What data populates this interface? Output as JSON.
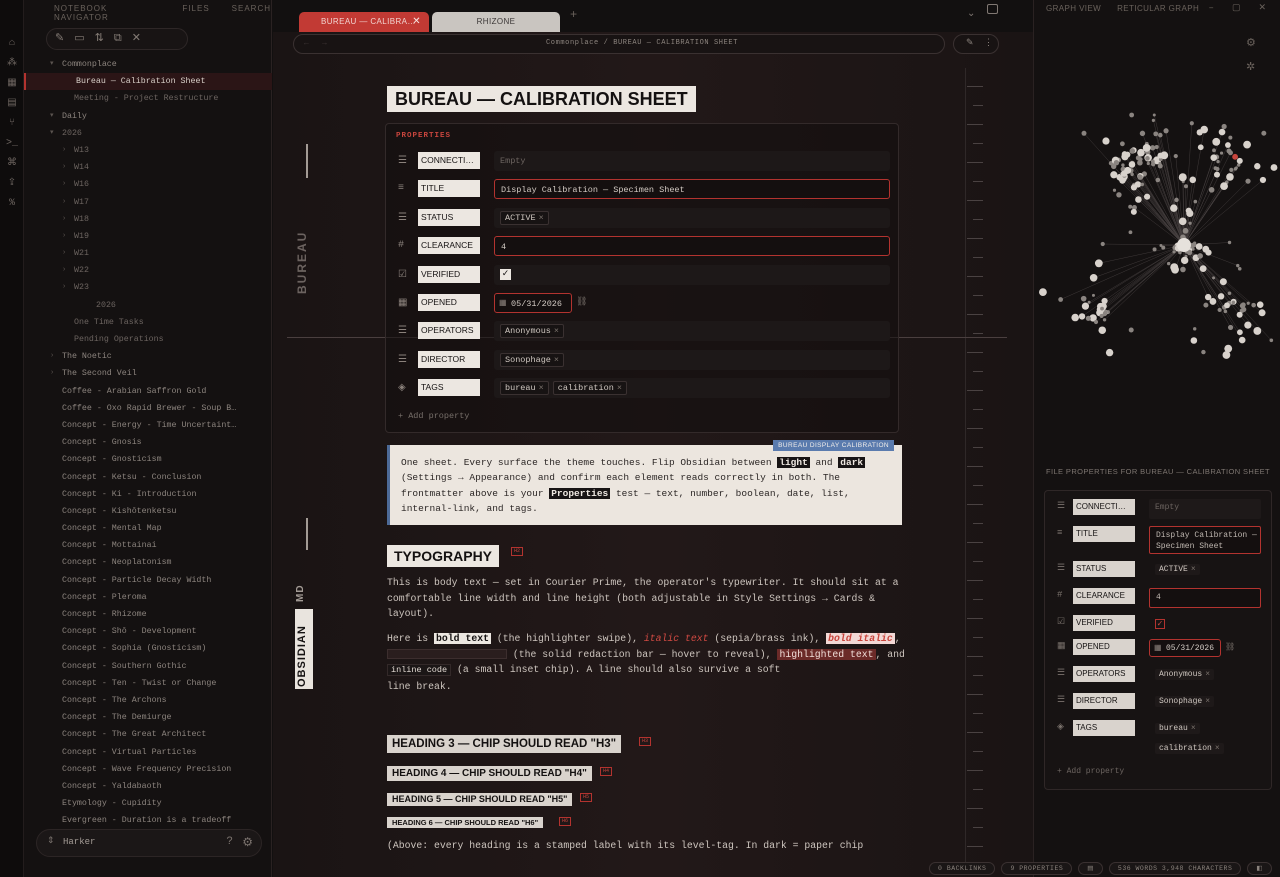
{
  "left_tabs": [
    "NOTEBOOK NAVIGATOR",
    "FILES",
    "SEARCH"
  ],
  "ribbon_icons": [
    "files-icon",
    "graph-icon",
    "calendar-icon",
    "template-icon",
    "branch-icon",
    "terminal-icon",
    "command-icon",
    "publish-icon",
    "tag-icon"
  ],
  "tree": [
    {
      "label": "Commonplace",
      "indent": 1,
      "caret": "▾"
    },
    {
      "label": "Bureau — Calibration Sheet",
      "indent": 3,
      "active": true
    },
    {
      "label": "Meeting - Project Restructure",
      "indent": 3
    },
    {
      "label": "Daily",
      "indent": 1,
      "caret": "▾"
    },
    {
      "label": "2026",
      "indent": 2,
      "caret": "▾"
    },
    {
      "label": "W13",
      "indent": 3,
      "caret": "›"
    },
    {
      "label": "W14",
      "indent": 3,
      "caret": "›"
    },
    {
      "label": "W16",
      "indent": 3,
      "caret": "›"
    },
    {
      "label": "W17",
      "indent": 3,
      "caret": "›"
    },
    {
      "label": "W18",
      "indent": 3,
      "caret": "›"
    },
    {
      "label": "W19",
      "indent": 3,
      "caret": "›"
    },
    {
      "label": "W21",
      "indent": 3,
      "caret": "›"
    },
    {
      "label": "W22",
      "indent": 3,
      "caret": "›"
    },
    {
      "label": "W23",
      "indent": 3,
      "caret": "›"
    },
    {
      "label": "2026",
      "indent": 4
    },
    {
      "label": "One Time Tasks",
      "indent": 3
    },
    {
      "label": "Pending Operations",
      "indent": 3
    },
    {
      "label": "The Noetic",
      "indent": 1,
      "caret": "›"
    },
    {
      "label": "The Second Veil",
      "indent": 1,
      "caret": "›"
    },
    {
      "label": "Coffee - Arabian Saffron Gold",
      "indent": 1
    },
    {
      "label": "Coffee - Oxo Rapid Brewer - Soup B…",
      "indent": 1
    },
    {
      "label": "Concept - Energy - Time Uncertaint…",
      "indent": 1
    },
    {
      "label": "Concept - Gnosis",
      "indent": 1
    },
    {
      "label": "Concept - Gnosticism",
      "indent": 1
    },
    {
      "label": "Concept - Ketsu - Conclusion",
      "indent": 1
    },
    {
      "label": "Concept - Ki - Introduction",
      "indent": 1
    },
    {
      "label": "Concept - Kishōtenketsu",
      "indent": 1
    },
    {
      "label": "Concept - Mental Map",
      "indent": 1
    },
    {
      "label": "Concept - Mottainai",
      "indent": 1
    },
    {
      "label": "Concept - Neoplatonism",
      "indent": 1
    },
    {
      "label": "Concept - Particle Decay Width",
      "indent": 1
    },
    {
      "label": "Concept - Pleroma",
      "indent": 1
    },
    {
      "label": "Concept - Rhizome",
      "indent": 1
    },
    {
      "label": "Concept - Shō - Development",
      "indent": 1
    },
    {
      "label": "Concept - Sophia (Gnosticism)",
      "indent": 1
    },
    {
      "label": "Concept - Southern Gothic",
      "indent": 1
    },
    {
      "label": "Concept - Ten - Twist or Change",
      "indent": 1
    },
    {
      "label": "Concept - The Archons",
      "indent": 1
    },
    {
      "label": "Concept - The Demiurge",
      "indent": 1
    },
    {
      "label": "Concept - The Great Architect",
      "indent": 1
    },
    {
      "label": "Concept - Virtual Particles",
      "indent": 1
    },
    {
      "label": "Concept - Wave Frequency Precision",
      "indent": 1
    },
    {
      "label": "Concept - Yaldabaoth",
      "indent": 1
    },
    {
      "label": "Etymology - Cupidity",
      "indent": 1
    },
    {
      "label": "Evergreen - Duration is a tradeoff",
      "indent": 1
    }
  ],
  "vault": {
    "name": "Harker"
  },
  "tabs": [
    {
      "label": "BUREAU — CALIBRA…",
      "active": true
    },
    {
      "label": "RHIZONE",
      "active": false
    }
  ],
  "breadcrumb": "Commonplace / BUREAU — CALIBRATION SHEET",
  "side_labels": {
    "bureau": "BUREAU",
    "obsidian": "OBSIDIAN",
    "md": "MD"
  },
  "note": {
    "title": "BUREAU — CALIBRATION SHEET",
    "properties_heading": "PROPERTIES",
    "add_property": "+ Add property",
    "properties": [
      {
        "key": "CONNECTI…",
        "icon": "list-icon",
        "type": "empty",
        "value": "Empty"
      },
      {
        "key": "TITLE",
        "icon": "text-icon",
        "type": "text",
        "value": "Display Calibration — Specimen Sheet"
      },
      {
        "key": "STATUS",
        "icon": "list-icon",
        "type": "pills",
        "values": [
          "ACTIVE"
        ]
      },
      {
        "key": "CLEARANCE",
        "icon": "number-icon",
        "type": "text",
        "value": "4"
      },
      {
        "key": "VERIFIED",
        "icon": "checkbox-icon",
        "type": "check",
        "value": "✓"
      },
      {
        "key": "OPENED",
        "icon": "calendar-icon",
        "type": "date",
        "value": "05/31/2026"
      },
      {
        "key": "OPERATORS",
        "icon": "list-icon",
        "type": "pills",
        "values": [
          "Anonymous"
        ]
      },
      {
        "key": "DIRECTOR",
        "icon": "list-icon",
        "type": "pills",
        "values": [
          "Sonophage"
        ]
      },
      {
        "key": "TAGS",
        "icon": "tag-icon",
        "type": "pills",
        "values": [
          "bureau",
          "calibration"
        ]
      }
    ],
    "callout": {
      "tag": "BUREAU DISPLAY CALIBRATION",
      "t1": "One sheet. Every surface the theme touches. Flip Obsidian between ",
      "light": "light",
      "t2": " and ",
      "dark": "dark",
      "t3": " (Settings → Appearance) and confirm each element reads correctly in both. The frontmatter above is your ",
      "properties": "Properties",
      "t4": " test — text, number, boolean, date, list, internal-link, and tags."
    },
    "typography_heading": "TYPOGRAPHY",
    "h2_level": "H2",
    "para1": "This is body text — set in Courier Prime, the operator's typewriter. It should sit at a comfortable line width and line height (both adjustable in Style Settings → Cards & layout).",
    "para2": {
      "a": "Here is ",
      "bold": "bold text",
      "b": " (the highlighter swipe), ",
      "italic": "italic text",
      "c": " (sepia/brass ink), ",
      "bolditalic": "bold italic",
      "d": ", ",
      "e": " (the solid redaction bar — hover to reveal), ",
      "highlighted": "highlighted text",
      "f": ", and ",
      "code": "inline code",
      "g": " (a small inset chip). A line should also survive a soft",
      "h": "line break."
    },
    "headings": [
      {
        "text": "HEADING 3 — CHIP SHOULD READ \"H3\"",
        "level": "H3"
      },
      {
        "text": "HEADING 4 — CHIP SHOULD READ \"H4\"",
        "level": "H4"
      },
      {
        "text": "HEADING 5 — CHIP SHOULD READ \"H5\"",
        "level": "H5"
      },
      {
        "text": "HEADING 6 — CHIP SHOULD READ \"H6\"",
        "level": "H6"
      }
    ],
    "para3": "(Above: every heading is a stamped label with its level-tag. In dark = paper chip"
  },
  "right_tabs": [
    "GRAPH VIEW",
    "RETICULAR GRAPH"
  ],
  "file_properties_title": "FILE PROPERTIES FOR BUREAU — CALIBRATION SHEET",
  "file_properties": [
    {
      "key": "CONNECTI…",
      "type": "empty",
      "value": "Empty"
    },
    {
      "key": "TITLE",
      "type": "text",
      "value": "Display Calibration — Specimen Sheet"
    },
    {
      "key": "STATUS",
      "type": "pills",
      "values": [
        "ACTIVE"
      ]
    },
    {
      "key": "CLEARANCE",
      "type": "text",
      "value": "4"
    },
    {
      "key": "VERIFIED",
      "type": "check",
      "value": "✓"
    },
    {
      "key": "OPENED",
      "type": "date",
      "value": "05/31/2026"
    },
    {
      "key": "OPERATORS",
      "type": "pills",
      "values": [
        "Anonymous"
      ]
    },
    {
      "key": "DIRECTOR",
      "type": "pills",
      "values": [
        "Sonophage"
      ]
    },
    {
      "key": "TAGS",
      "type": "pills",
      "values": [
        "bureau",
        "calibration"
      ]
    }
  ],
  "file_add_property": "+ Add property",
  "status_bar": {
    "backlinks": "0 BACKLINKS",
    "properties": "9 PROPERTIES",
    "words": "536 WORDS 3,948 CHARACTERS"
  },
  "colors": {
    "accent": "#b3332f",
    "paper": "#ece7e1",
    "callout_border": "#4d6a97"
  }
}
